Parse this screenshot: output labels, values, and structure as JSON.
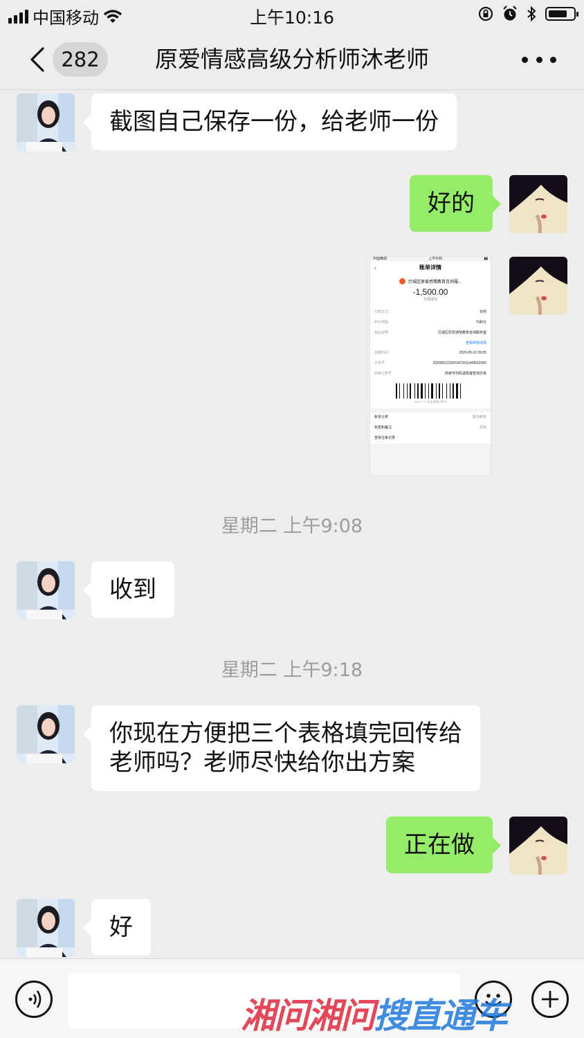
{
  "status_bar": {
    "carrier": "中国移动",
    "time": "上午10:16",
    "battery_level": 0.75
  },
  "nav": {
    "back_icon": "chevron-left-icon",
    "unread_count": "282",
    "title": "原爱情感高级分析师沐老师",
    "more_icon": "more-dots-icon"
  },
  "messages": [
    {
      "side": "in",
      "text": "截图自己保存一份，给老师一份"
    },
    {
      "side": "out",
      "text": "好的"
    },
    {
      "side": "out",
      "type": "image"
    },
    {
      "type": "time",
      "text": "星期二 上午9:08"
    },
    {
      "side": "in",
      "text": "收到"
    },
    {
      "type": "time",
      "text": "星期二 上午9:18"
    },
    {
      "side": "in",
      "lines": [
        "你现在方便把三个表格填完回传给",
        "老师吗？老师尽快给你出方案"
      ]
    },
    {
      "side": "out",
      "text": "正在做"
    },
    {
      "side": "in",
      "text": "好"
    }
  ],
  "receipt": {
    "status_carrier": "中国移动",
    "status_time": "上午9:05",
    "title": "账单详情",
    "merchant": "历城区原爱感情教育咨询服...",
    "amount": "-1,500.00",
    "status": "交易成功",
    "rows": [
      {
        "k": "付款方式",
        "v": "花呗"
      },
      {
        "k": "积分奖励",
        "v": "75积分"
      },
      {
        "k": "商品说明",
        "v": "历城区原爱感情教育咨询服务室"
      }
    ],
    "link": "查看购物详情",
    "rows2": [
      {
        "k": "创建时间",
        "v": "2020-05-12 09:05"
      },
      {
        "k": "订单号",
        "v": "20200512220014734114445520​90"
      },
      {
        "k": "商家订单号",
        "v": "商家可扫码退款或查询交易"
      }
    ],
    "barcode_note": "3915 ***** 点击查看订单号",
    "sections": [
      {
        "k": "账单分类",
        "v": "图书教育"
      },
      {
        "k": "标签和备注",
        "v": "添加"
      },
      {
        "k": "查看往来记录",
        "v": ""
      }
    ]
  },
  "input_bar": {
    "voice_icon": "voice-icon",
    "placeholder": "",
    "emoji_icon": "emoji-icon",
    "plus_icon": "plus-icon"
  },
  "watermark": {
    "red": "湘问湘问",
    "blue": "搜直通车"
  },
  "colors": {
    "background": "#ededed",
    "bubble_out": "#95ec69",
    "bubble_in": "#ffffff",
    "time_text": "#9c9c9c"
  }
}
